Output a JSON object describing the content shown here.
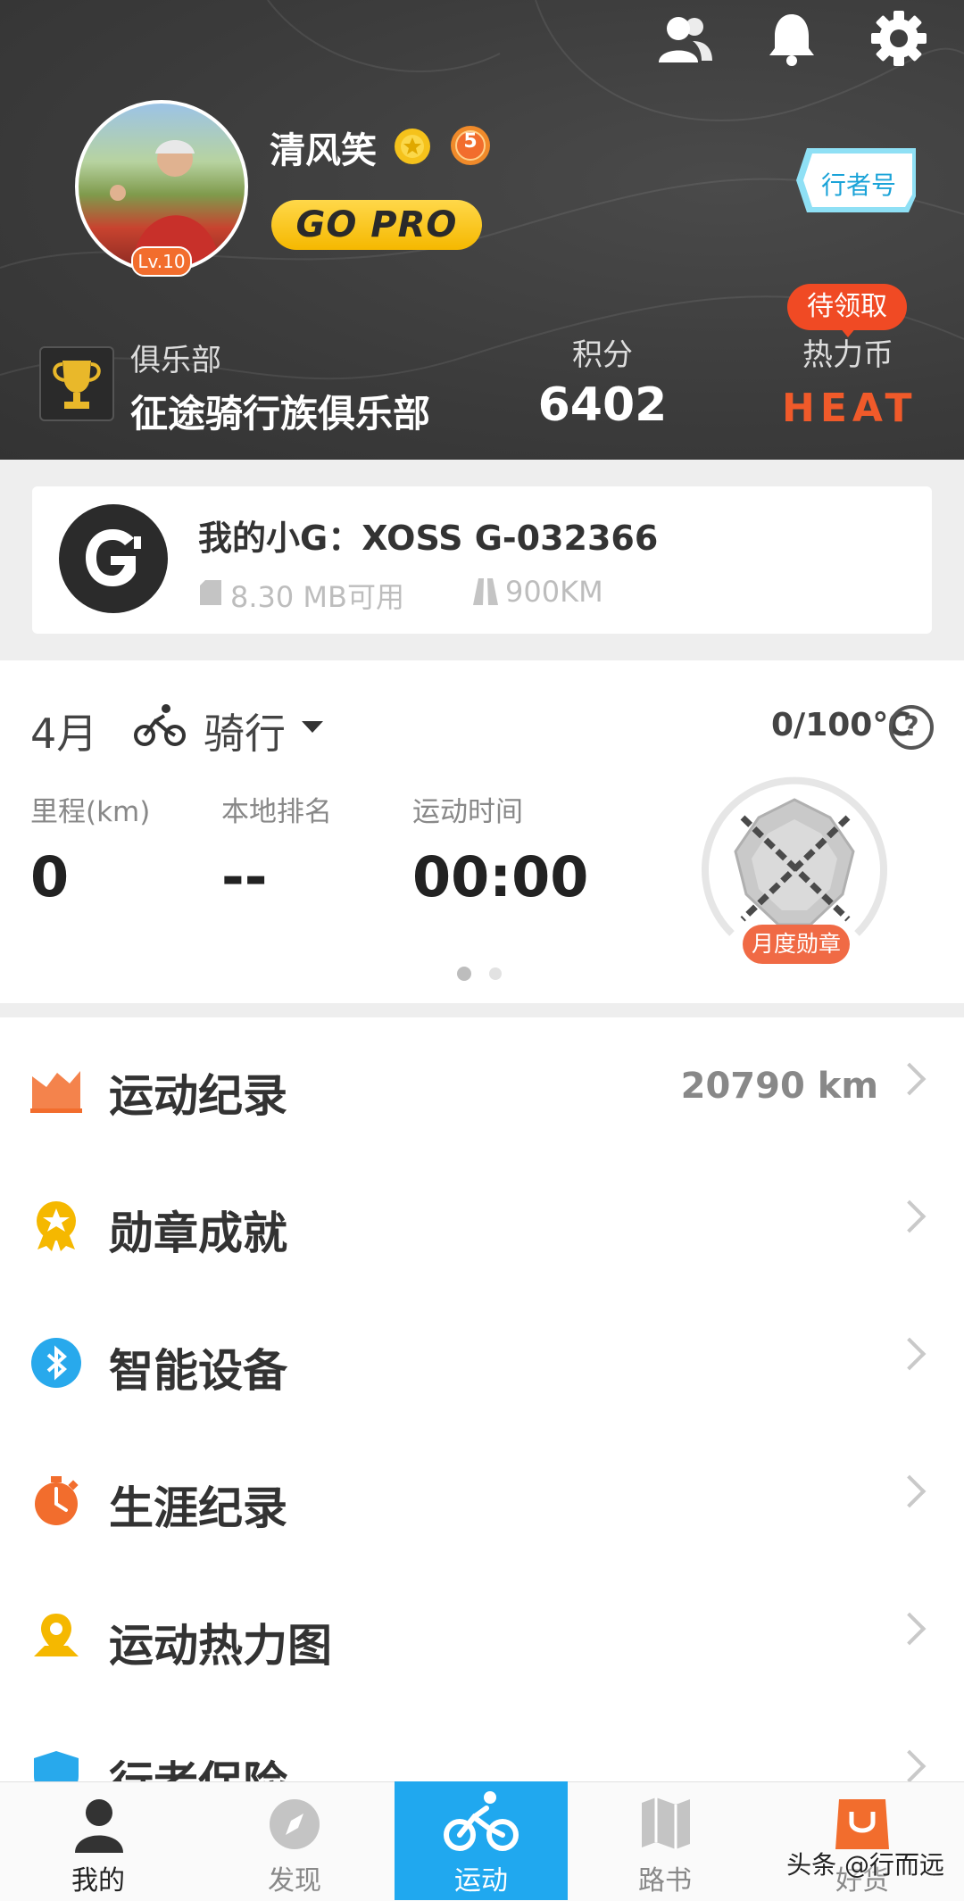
{
  "header": {
    "username": "清风笑",
    "level_badge": "Lv.10",
    "rank_badge_number": "5",
    "pro_button": "GO PRO",
    "xingzhe_tag": "行者号",
    "club_label": "俱乐部",
    "club_name": "征途骑行族俱乐部",
    "points_label": "积分",
    "points_value": "6402",
    "heat_label": "热力币",
    "heat_badge": "待领取",
    "heat_logo": "HEAT",
    "top_icons": [
      "friends-icon",
      "bell-icon",
      "gear-icon"
    ]
  },
  "device": {
    "title": "我的小G：XOSS G-032366",
    "storage": "8.30 MB可用",
    "range": "900KM"
  },
  "stats": {
    "month": "4月",
    "sport": "骑行",
    "temperature": "0/100℃",
    "help": "?",
    "mileage_label": "里程(km)",
    "mileage_value": "0",
    "rank_label": "本地排名",
    "rank_value": "--",
    "time_label": "运动时间",
    "time_value": "00:00",
    "monthly_medal": "月度勋章",
    "page_indicator": {
      "count": 2,
      "active": 0
    }
  },
  "menu": [
    {
      "label": "运动纪录",
      "value": "20790 km",
      "icon": "chart-icon"
    },
    {
      "label": "勋章成就",
      "value": "",
      "icon": "medal-icon"
    },
    {
      "label": "智能设备",
      "value": "",
      "icon": "bluetooth-icon"
    },
    {
      "label": "生涯纪录",
      "value": "",
      "icon": "stopwatch-icon"
    },
    {
      "label": "运动热力图",
      "value": "",
      "icon": "map-pin-icon"
    },
    {
      "label": "行者保险",
      "value": "",
      "icon": "insurance-icon"
    }
  ],
  "nav": [
    {
      "label": "我的",
      "icon": "person-icon"
    },
    {
      "label": "发现",
      "icon": "compass-icon"
    },
    {
      "label": "运动",
      "icon": "bike-icon"
    },
    {
      "label": "路书",
      "icon": "map-icon"
    },
    {
      "label": "好货",
      "icon": "shop-bag-icon"
    }
  ],
  "watermark": "头条 @行而远",
  "colors": {
    "header_bg": "#3e3e3e",
    "accent_blue": "#20a8ef",
    "accent_orange": "#f26d2d",
    "gold": "#f5b800"
  }
}
